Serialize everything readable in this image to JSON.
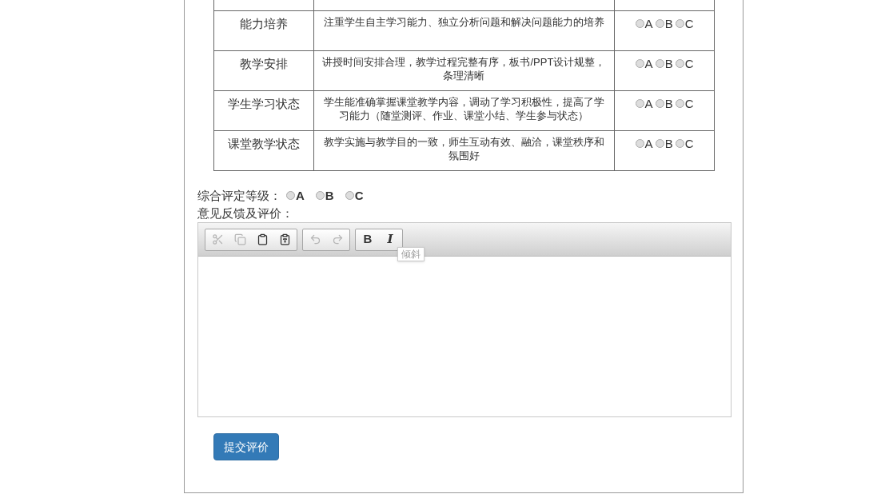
{
  "criteria": [
    {
      "item": "能力培养",
      "description": "注重学生自主学习能力、独立分析问题和解决问题能力的培养",
      "options": [
        {
          "label": "A",
          "selected": false
        },
        {
          "label": "B",
          "selected": false
        },
        {
          "label": "C",
          "selected": false
        }
      ]
    },
    {
      "item": "教学安排",
      "description": "讲授时间安排合理，教学过程完整有序，板书/PPT设计规整，条理清晰",
      "options": [
        {
          "label": "A",
          "selected": false
        },
        {
          "label": "B",
          "selected": false
        },
        {
          "label": "C",
          "selected": false
        }
      ]
    },
    {
      "item": "学生学习状态",
      "description": "学生能准确掌握课堂教学内容，调动了学习积极性，提高了学习能力（随堂测评、作业、课堂小结、学生参与状态）",
      "options": [
        {
          "label": "A",
          "selected": false
        },
        {
          "label": "B",
          "selected": false
        },
        {
          "label": "C",
          "selected": false
        }
      ]
    },
    {
      "item": "课堂教学状态",
      "description": "教学实施与教学目的一致，师生互动有效、融洽，课堂秩序和氛围好",
      "options": [
        {
          "label": "A",
          "selected": false
        },
        {
          "label": "B",
          "selected": false
        },
        {
          "label": "C",
          "selected": false
        }
      ]
    }
  ],
  "overall": {
    "label": "综合评定等级：",
    "options": [
      {
        "label": "A",
        "selected": false
      },
      {
        "label": "B",
        "selected": false
      },
      {
        "label": "C",
        "selected": false
      }
    ]
  },
  "feedback": {
    "label": "意见反馈及评价：",
    "toolbar": [
      [
        {
          "kind": "cut",
          "disabled": true
        },
        {
          "kind": "copy",
          "disabled": true
        },
        {
          "kind": "paste",
          "disabled": false
        },
        {
          "kind": "paste-text",
          "disabled": false
        }
      ],
      [
        {
          "kind": "undo",
          "disabled": true
        },
        {
          "kind": "redo",
          "disabled": true
        }
      ],
      [
        {
          "kind": "bold",
          "label": "B",
          "disabled": false
        },
        {
          "kind": "italic",
          "label": "I",
          "disabled": false
        }
      ]
    ],
    "tooltip": "倾斜"
  },
  "submit_button": "提交评价"
}
